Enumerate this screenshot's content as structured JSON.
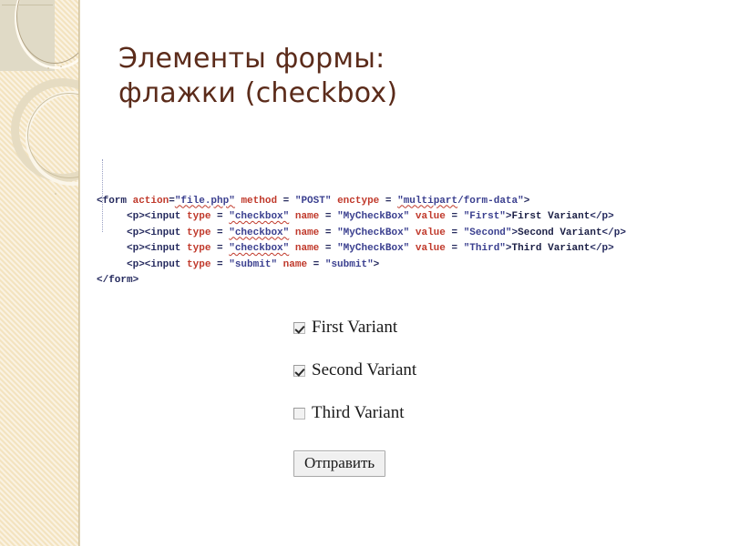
{
  "slide": {
    "title_lines": [
      "Элементы формы:",
      "флажки (checkbox)"
    ],
    "title_color": "#5b2b1a",
    "background_color": "#ffffff",
    "band_color": "#f3e3bf"
  },
  "code": {
    "language": "html",
    "colors": {
      "tag": "#252a5e",
      "attribute": "#c0392b",
      "value": "#3a3f8f",
      "text": "#1b1f45"
    },
    "lines": [
      {
        "indent": 0,
        "tokens": [
          {
            "type": "tag",
            "text": "<form "
          },
          {
            "type": "attr",
            "text": "action"
          },
          {
            "type": "punct",
            "text": "="
          },
          {
            "type": "val",
            "text": "\"file.php\"",
            "squiggle": true
          },
          {
            "type": "attr",
            "text": " method "
          },
          {
            "type": "punct",
            "text": "= "
          },
          {
            "type": "val",
            "text": "\"POST\""
          },
          {
            "type": "attr",
            "text": " enctype "
          },
          {
            "type": "punct",
            "text": "= "
          },
          {
            "type": "val",
            "text": "\"multipart",
            "squiggle": true
          },
          {
            "type": "val",
            "text": "/form-data\""
          },
          {
            "type": "tag",
            "text": ">"
          }
        ]
      },
      {
        "indent": 1,
        "tokens": [
          {
            "type": "tag",
            "text": "<p><input "
          },
          {
            "type": "attr",
            "text": "type "
          },
          {
            "type": "punct",
            "text": "= "
          },
          {
            "type": "val",
            "text": "\"checkbox\"",
            "squiggle": true
          },
          {
            "type": "attr",
            "text": " name "
          },
          {
            "type": "punct",
            "text": "= "
          },
          {
            "type": "val",
            "text": "\"MyCheckBox\""
          },
          {
            "type": "attr",
            "text": " value "
          },
          {
            "type": "punct",
            "text": "= "
          },
          {
            "type": "val",
            "text": "\"First\""
          },
          {
            "type": "tag",
            "text": ">"
          },
          {
            "type": "text",
            "text": "First Variant"
          },
          {
            "type": "tag",
            "text": "</p>"
          }
        ]
      },
      {
        "indent": 1,
        "tokens": [
          {
            "type": "tag",
            "text": "<p><input "
          },
          {
            "type": "attr",
            "text": "type "
          },
          {
            "type": "punct",
            "text": "= "
          },
          {
            "type": "val",
            "text": "\"checkbox\"",
            "squiggle": true
          },
          {
            "type": "attr",
            "text": " name "
          },
          {
            "type": "punct",
            "text": "= "
          },
          {
            "type": "val",
            "text": "\"MyCheckBox\""
          },
          {
            "type": "attr",
            "text": " value "
          },
          {
            "type": "punct",
            "text": "= "
          },
          {
            "type": "val",
            "text": "\"Second\""
          },
          {
            "type": "tag",
            "text": ">"
          },
          {
            "type": "text",
            "text": "Second Variant"
          },
          {
            "type": "tag",
            "text": "</p>"
          }
        ]
      },
      {
        "indent": 1,
        "tokens": [
          {
            "type": "tag",
            "text": "<p><input "
          },
          {
            "type": "attr",
            "text": "type "
          },
          {
            "type": "punct",
            "text": "= "
          },
          {
            "type": "val",
            "text": "\"checkbox\"",
            "squiggle": true
          },
          {
            "type": "attr",
            "text": " name "
          },
          {
            "type": "punct",
            "text": "= "
          },
          {
            "type": "val",
            "text": "\"MyCheckBox\""
          },
          {
            "type": "attr",
            "text": " value "
          },
          {
            "type": "punct",
            "text": "= "
          },
          {
            "type": "val",
            "text": "\"Third\""
          },
          {
            "type": "tag",
            "text": ">"
          },
          {
            "type": "text",
            "text": "Third Variant"
          },
          {
            "type": "tag",
            "text": "</p>"
          }
        ]
      },
      {
        "indent": 1,
        "tokens": [
          {
            "type": "tag",
            "text": "<p><input "
          },
          {
            "type": "attr",
            "text": "type "
          },
          {
            "type": "punct",
            "text": "= "
          },
          {
            "type": "val",
            "text": "\"submit\""
          },
          {
            "type": "attr",
            "text": " name "
          },
          {
            "type": "punct",
            "text": "= "
          },
          {
            "type": "val",
            "text": "\"submit\""
          },
          {
            "type": "tag",
            "text": ">"
          }
        ]
      },
      {
        "indent": 0,
        "tokens": [
          {
            "type": "tag",
            "text": "</form>"
          }
        ]
      }
    ]
  },
  "demo": {
    "checkboxes": [
      {
        "label": "First Variant",
        "checked": true,
        "value": "First"
      },
      {
        "label": "Second Variant",
        "checked": true,
        "value": "Second"
      },
      {
        "label": "Third Variant",
        "checked": false,
        "value": "Third"
      }
    ],
    "submit_label": "Отправить"
  }
}
